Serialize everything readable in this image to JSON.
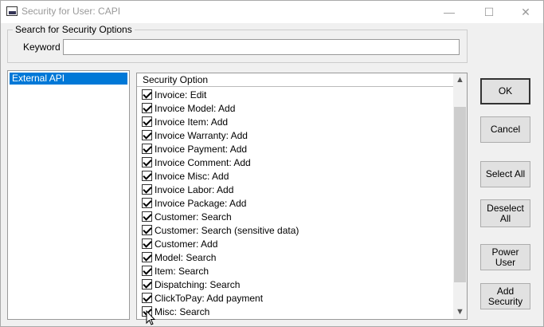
{
  "window": {
    "title": "Security for User: CAPI",
    "minimize_glyph": "—",
    "maximize_glyph": "☐",
    "close_glyph": "✕"
  },
  "search": {
    "group_label": "Search for Security Options",
    "keyword_label": "Keyword",
    "keyword_value": ""
  },
  "left_list": {
    "items": [
      "External API"
    ]
  },
  "options": {
    "column_header": "Security Option",
    "items": [
      "Invoice: Edit",
      "Invoice Model: Add",
      "Invoice Item: Add",
      "Invoice Warranty: Add",
      "Invoice Payment: Add",
      "Invoice Comment: Add",
      "Invoice Misc: Add",
      "Invoice Labor: Add",
      "Invoice Package: Add",
      "Customer: Search",
      "Customer: Search (sensitive data)",
      "Customer: Add",
      "Model: Search",
      "Item: Search",
      "Dispatching: Search",
      "ClickToPay: Add payment",
      "Misc: Search"
    ]
  },
  "buttons": {
    "ok": "OK",
    "cancel": "Cancel",
    "select_all": "Select All",
    "deselect_all": "Deselect All",
    "power_user": "Power User",
    "add_security": "Add Security"
  },
  "colors": {
    "selection": "#0078d7",
    "window_bg": "#f0f0f0"
  }
}
